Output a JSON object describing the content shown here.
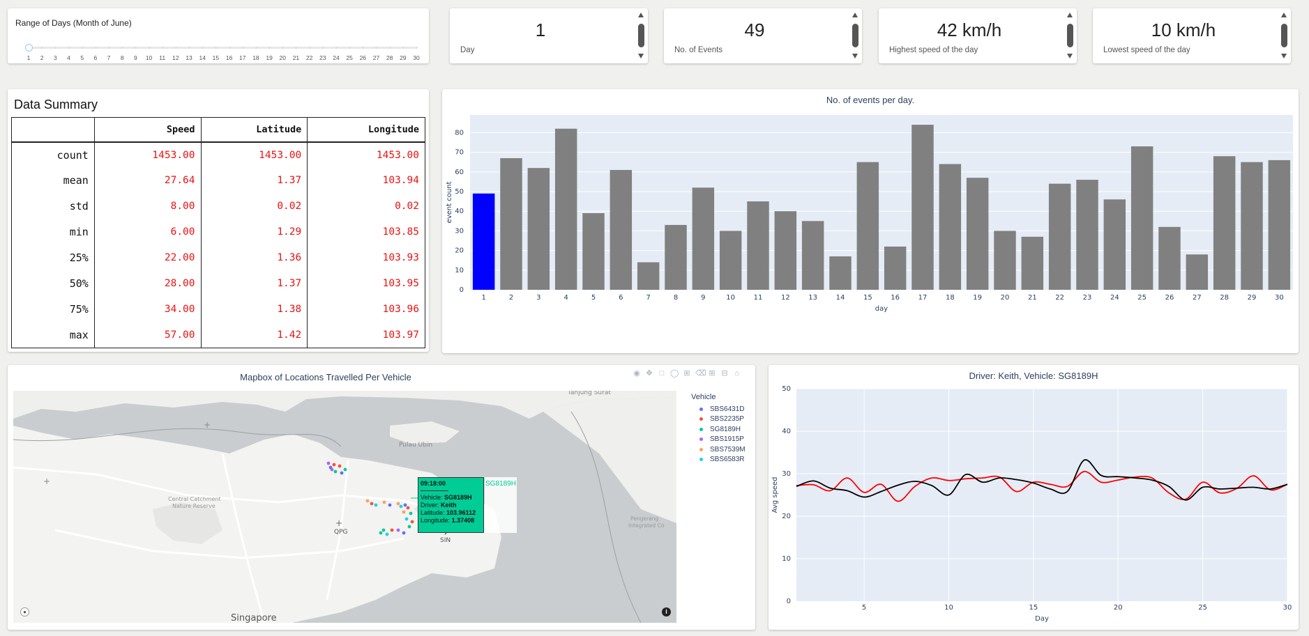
{
  "slider": {
    "title": "Range of Days (Month of June)",
    "min": 1,
    "max": 30,
    "value": 1,
    "marks": [
      "1",
      "2",
      "3",
      "4",
      "5",
      "6",
      "7",
      "8",
      "9",
      "10",
      "11",
      "12",
      "13",
      "14",
      "15",
      "16",
      "17",
      "18",
      "19",
      "20",
      "21",
      "22",
      "23",
      "24",
      "25",
      "26",
      "27",
      "28",
      "29",
      "30"
    ]
  },
  "stats": [
    {
      "value": "1",
      "label": "Day"
    },
    {
      "value": "49",
      "label": "No. of Events"
    },
    {
      "value": "42 km/h",
      "label": "Highest speed of the day"
    },
    {
      "value": "10 km/h",
      "label": "Lowest speed of the day"
    }
  ],
  "summary": {
    "title": "Data Summary",
    "columns": [
      "",
      "Speed",
      "Latitude",
      "Longitude"
    ],
    "rows": [
      {
        "stat": "count",
        "speed": "1453.00",
        "lat": "1453.00",
        "lon": "1453.00"
      },
      {
        "stat": "mean",
        "speed": "27.64",
        "lat": "1.37",
        "lon": "103.94"
      },
      {
        "stat": "std",
        "speed": "8.00",
        "lat": "0.02",
        "lon": "0.02"
      },
      {
        "stat": "min",
        "speed": "6.00",
        "lat": "1.29",
        "lon": "103.85"
      },
      {
        "stat": "25%",
        "speed": "22.00",
        "lat": "1.36",
        "lon": "103.93"
      },
      {
        "stat": "50%",
        "speed": "28.00",
        "lat": "1.37",
        "lon": "103.95"
      },
      {
        "stat": "75%",
        "speed": "34.00",
        "lat": "1.38",
        "lon": "103.96"
      },
      {
        "stat": "max",
        "speed": "57.00",
        "lat": "1.42",
        "lon": "103.97"
      }
    ]
  },
  "map": {
    "title": "Mapbox of Locations Travelled Per Vehicle",
    "legend_title": "Vehicle",
    "vehicles": [
      {
        "name": "SBS6431D",
        "color": "#636efa"
      },
      {
        "name": "SBS2235P",
        "color": "#ef553b"
      },
      {
        "name": "SG8189H",
        "color": "#00cc96"
      },
      {
        "name": "SBS1915P",
        "color": "#ab63fa"
      },
      {
        "name": "SBS7539M",
        "color": "#ffa15a"
      },
      {
        "name": "SBS6583R",
        "color": "#19d3f3"
      }
    ],
    "place_labels": [
      "Tanjung Surat",
      "Pulau Ubin",
      "Central Catchment Nature Reserve",
      "QPG",
      "SIN",
      "Pengerang Integrated Co",
      "Singapore"
    ],
    "tooltip": {
      "time": "09:18:00",
      "vehicle_label": "Vehicle:",
      "vehicle": "SG8189H",
      "driver_label": "Driver:",
      "driver": "Keith",
      "lat_label": "Latitude:",
      "lat": "103.96112",
      "lon_label": "Longitude:",
      "lon": "1.37408",
      "trace": "SG8189H"
    }
  },
  "chart_data": [
    {
      "type": "bar",
      "title": "No. of events per day.",
      "xlabel": "day",
      "ylabel": "event count",
      "categories": [
        "1",
        "2",
        "3",
        "4",
        "5",
        "6",
        "7",
        "8",
        "9",
        "10",
        "11",
        "12",
        "13",
        "14",
        "15",
        "16",
        "17",
        "18",
        "19",
        "20",
        "21",
        "22",
        "23",
        "24",
        "25",
        "26",
        "27",
        "28",
        "29",
        "30"
      ],
      "values": [
        49,
        67,
        62,
        82,
        39,
        61,
        14,
        33,
        52,
        30,
        45,
        40,
        35,
        17,
        65,
        22,
        84,
        64,
        57,
        30,
        27,
        54,
        56,
        46,
        73,
        32,
        18,
        68,
        65,
        66
      ],
      "ylim": [
        0,
        89
      ],
      "yticks": [
        0,
        10,
        20,
        30,
        40,
        50,
        60,
        70,
        80
      ],
      "highlight_index": 0,
      "highlight_color": "#0000ff",
      "bar_color": "#808080",
      "plot_bg": "#e5ecf6"
    },
    {
      "type": "line",
      "title": "Driver: Keith, Vehicle: SG8189H",
      "xlabel": "Day",
      "ylabel": "Avg speed",
      "xlim": [
        1,
        30
      ],
      "ylim": [
        0,
        50
      ],
      "xticks": [
        5,
        10,
        15,
        20,
        25,
        30
      ],
      "yticks": [
        0,
        10,
        20,
        30,
        40,
        50
      ],
      "plot_bg": "#e5ecf6",
      "series": [
        {
          "color": "#ff0000",
          "x": [
            1,
            2,
            3,
            4,
            5,
            6,
            7,
            8,
            9,
            10,
            11,
            12,
            13,
            14,
            15,
            16,
            17,
            18,
            19,
            20,
            21,
            22,
            23,
            24,
            25,
            26,
            27,
            28,
            29,
            30
          ],
          "y": [
            27.2,
            27.4,
            26.0,
            29.0,
            25.6,
            27.5,
            23.5,
            27.0,
            29.0,
            28.4,
            28.8,
            29.0,
            29.2,
            25.8,
            28.0,
            27.5,
            27.0,
            30.5,
            28.0,
            28.5,
            29.2,
            29.0,
            25.5,
            24.0,
            28.0,
            25.5,
            26.5,
            29.5,
            26.2,
            27.5
          ]
        },
        {
          "color": "#000000",
          "x": [
            1,
            2,
            3,
            4,
            5,
            6,
            7,
            8,
            9,
            10,
            11,
            12,
            13,
            14,
            15,
            16,
            17,
            18,
            19,
            20,
            21,
            22,
            23,
            24,
            25,
            26,
            27,
            28,
            29,
            30
          ],
          "y": [
            27.0,
            28.3,
            26.6,
            26.0,
            24.5,
            25.8,
            27.3,
            28.2,
            27.2,
            25.0,
            29.8,
            28.0,
            29.0,
            28.6,
            27.8,
            26.4,
            25.8,
            33.2,
            29.6,
            29.3,
            29.0,
            28.5,
            27.0,
            23.8,
            26.8,
            26.4,
            26.6,
            26.8,
            26.4,
            27.5
          ]
        }
      ]
    }
  ]
}
